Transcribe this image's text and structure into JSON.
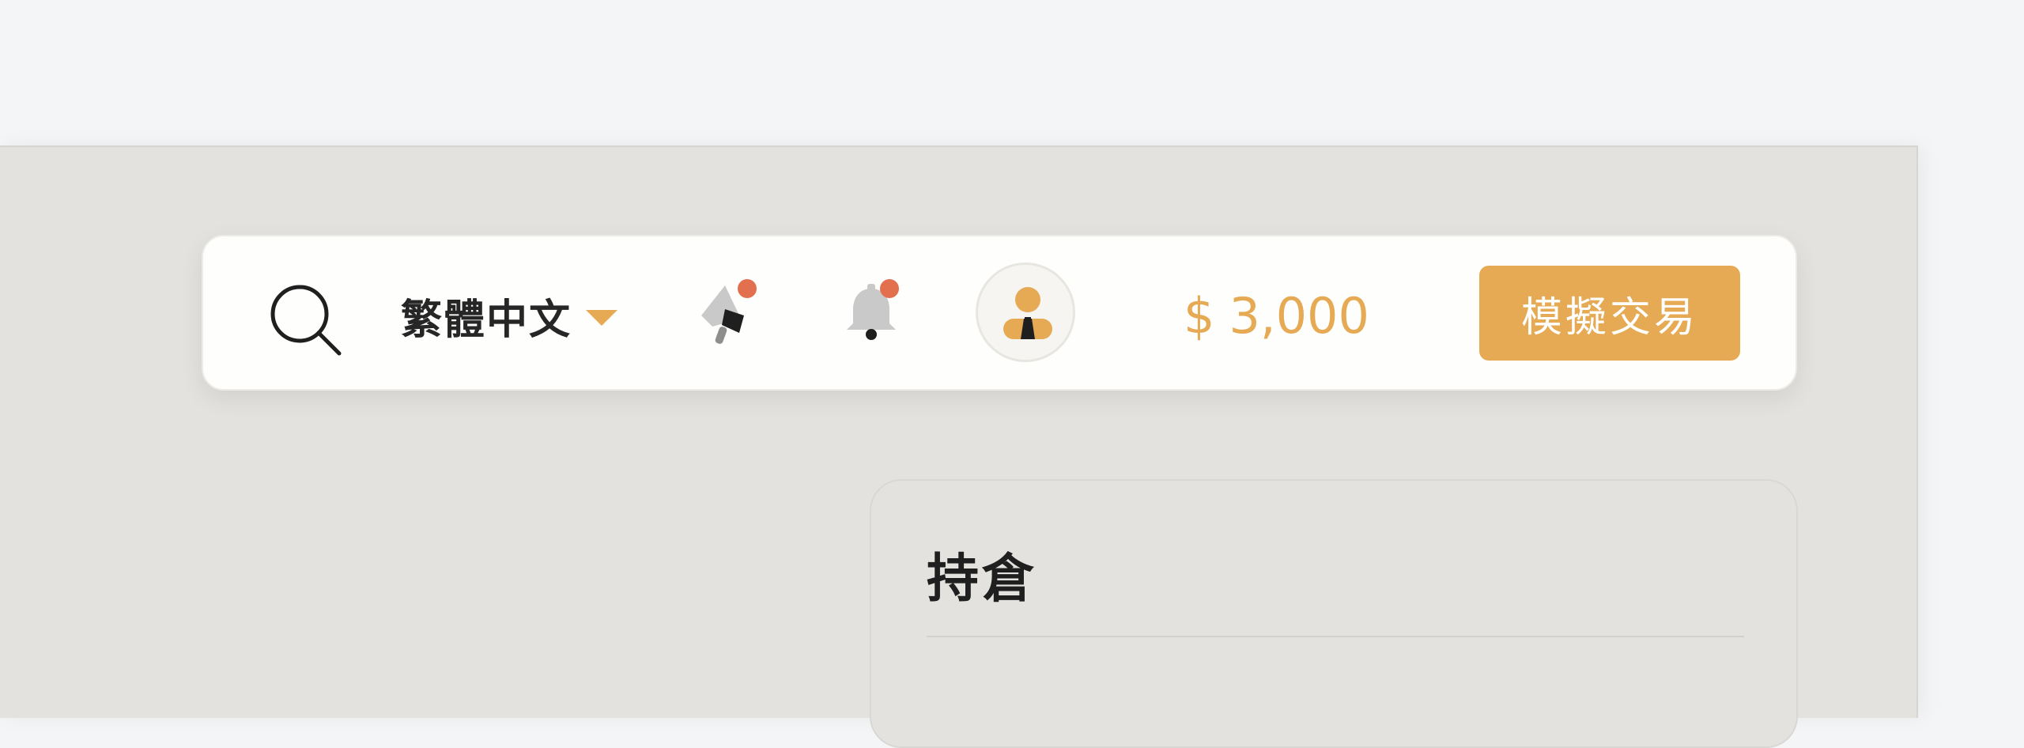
{
  "header": {
    "language": {
      "label": "繁體中文",
      "icon": "chevron-down-icon"
    },
    "icons": {
      "search": "search-icon",
      "announcement": "megaphone-icon",
      "notifications": "bell-icon",
      "profile": "avatar"
    },
    "balance": {
      "currency_symbol": "$",
      "amount": "3,000"
    },
    "cta_label": "模擬交易"
  },
  "positions_card": {
    "title": "持倉"
  },
  "colors": {
    "accent": "#e6aa55",
    "badge": "#e2704f",
    "panel_bg": "#e3e2df",
    "page_bg": "#f4f5f6"
  }
}
